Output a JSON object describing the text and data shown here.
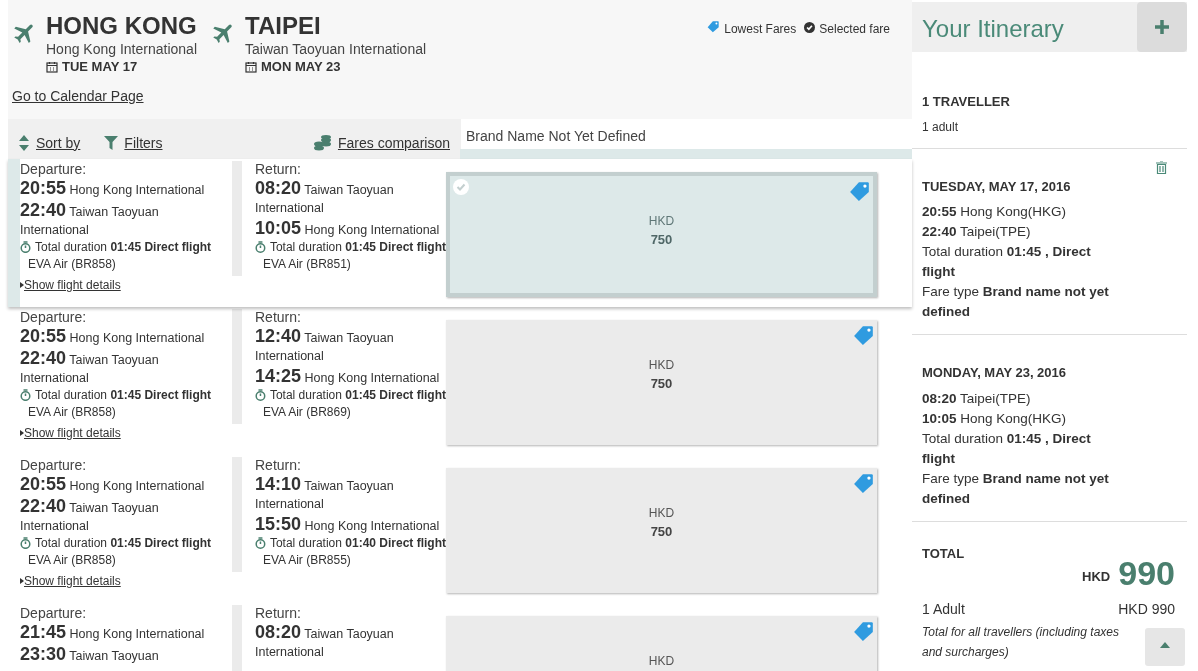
{
  "route": [
    {
      "city": "HONG KONG",
      "airport": "Hong Kong International",
      "date": "TUE MAY 17"
    },
    {
      "city": "TAIPEI",
      "airport": "Taiwan Taoyuan International",
      "date": "MON MAY 23"
    }
  ],
  "legend": [
    "Lowest Fares",
    "Selected fare"
  ],
  "calendar_link": "Go to Calendar Page",
  "toolbar": [
    {
      "kind": "sort",
      "label": "Sort by"
    },
    {
      "kind": "filter",
      "label": "Filters"
    },
    {
      "kind": "compare",
      "label": "Fares comparison"
    }
  ],
  "brand_header": "Brand Name Not Yet Defined",
  "results": [
    {
      "selected": true,
      "outbound": {
        "label": "Departure:",
        "segments": [
          {
            "time": "20:55",
            "airport": "Hong Kong International"
          },
          {
            "time": "22:40",
            "airport": "Taiwan Taoyuan International"
          }
        ],
        "duration": "Total duration **01:45 Direct flight**",
        "airline": "EVA Air (BR858)"
      },
      "inbound": {
        "label": "Return:",
        "segments": [
          {
            "time": "08:20",
            "airport": "Taiwan Taoyuan International"
          },
          {
            "time": "10:05",
            "airport": "Hong Kong International"
          }
        ],
        "duration": "Total duration **01:45 Direct flight**",
        "airline": "EVA Air (BR851)"
      },
      "details_link": "Show flight details",
      "fare": {
        "currency": "HKD",
        "price": "750",
        "lowest": true
      }
    },
    {
      "selected": false,
      "outbound": {
        "label": "Departure:",
        "segments": [
          {
            "time": "20:55",
            "airport": "Hong Kong International"
          },
          {
            "time": "22:40",
            "airport": "Taiwan Taoyuan International"
          }
        ],
        "duration": "Total duration **01:45 Direct flight**",
        "airline": "EVA Air (BR858)"
      },
      "inbound": {
        "label": "Return:",
        "segments": [
          {
            "time": "12:40",
            "airport": "Taiwan Taoyuan International"
          },
          {
            "time": "14:25",
            "airport": "Hong Kong International"
          }
        ],
        "duration": "Total duration **01:45 Direct flight**",
        "airline": "EVA Air (BR869)"
      },
      "details_link": "Show flight details",
      "fare": {
        "currency": "HKD",
        "price": "750",
        "lowest": true
      }
    },
    {
      "selected": false,
      "outbound": {
        "label": "Departure:",
        "segments": [
          {
            "time": "20:55",
            "airport": "Hong Kong International"
          },
          {
            "time": "22:40",
            "airport": "Taiwan Taoyuan International"
          }
        ],
        "duration": "Total duration **01:45 Direct flight**",
        "airline": "EVA Air (BR858)"
      },
      "inbound": {
        "label": "Return:",
        "segments": [
          {
            "time": "14:10",
            "airport": "Taiwan Taoyuan International"
          },
          {
            "time": "15:50",
            "airport": "Hong Kong International"
          }
        ],
        "duration": "Total duration **01:40 Direct flight**",
        "airline": "EVA Air (BR855)"
      },
      "details_link": "Show flight details",
      "fare": {
        "currency": "HKD",
        "price": "750",
        "lowest": true
      }
    },
    {
      "selected": false,
      "outbound": {
        "label": "Departure:",
        "segments": [
          {
            "time": "21:45",
            "airport": "Hong Kong International"
          },
          {
            "time": "23:30",
            "airport": "Taiwan Taoyuan"
          }
        ]
      },
      "inbound": {
        "label": "Return:",
        "segments": [
          {
            "time": "08:20",
            "airport": "Taiwan Taoyuan International"
          }
        ]
      },
      "fare": {
        "currency": "HKD",
        "lowest": true
      }
    }
  ],
  "itinerary": {
    "title": "Your Itinerary",
    "travellers_heading": "1 TRAVELLER",
    "travellers": "1 adult",
    "legs": [
      {
        "date": "TUESDAY, MAY 17, 2016",
        "deletable": true,
        "lines": [
          "**20:55** Hong Kong(HKG)",
          "**22:40** Taipei(TPE)",
          "Total duration **01:45 , Direct flight**",
          "Fare type **Brand name not yet defined**"
        ]
      },
      {
        "date": "MONDAY, MAY 23, 2016",
        "deletable": false,
        "lines": [
          "**08:20** Taipei(TPE)",
          "**10:05** Hong Kong(HKG)",
          "Total duration **01:45 , Direct flight**",
          "Fare type **Brand name not yet defined**"
        ]
      }
    ],
    "total_heading": "TOTAL",
    "total_currency": "HKD",
    "total_amount": "990",
    "passenger": "1 Adult",
    "passenger_amount": "HKD 990",
    "note": "Total for all travellers (including taxes and surcharges)"
  }
}
